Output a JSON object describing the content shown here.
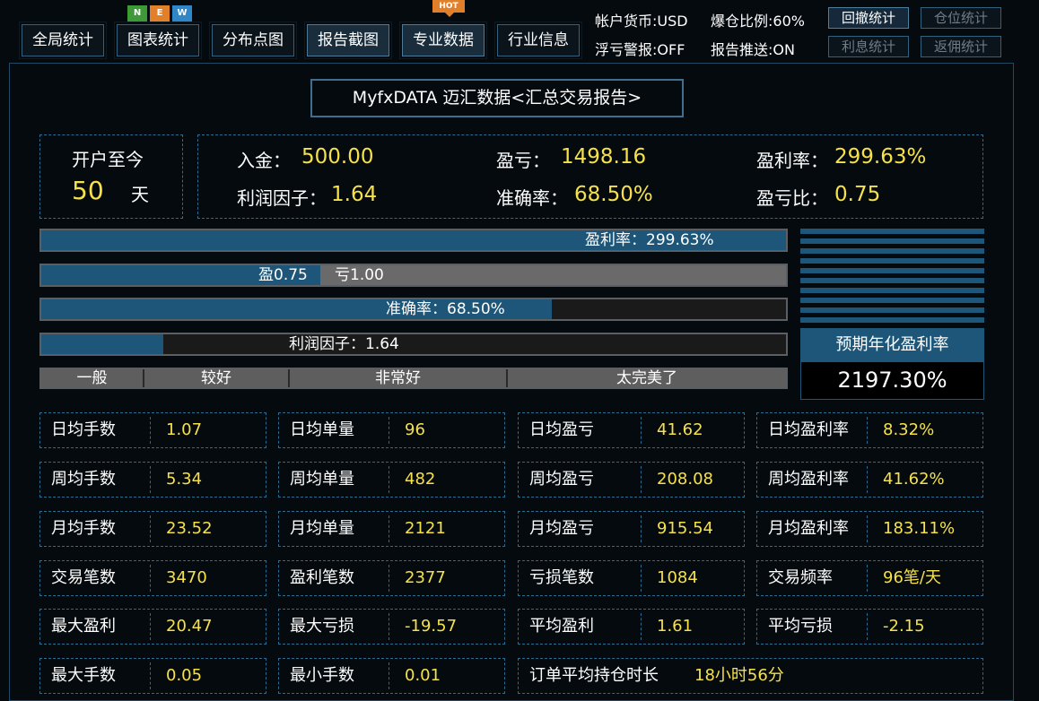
{
  "nav": {
    "tabs": [
      {
        "label": "全局统计",
        "active": false
      },
      {
        "label": "图表统计",
        "active": false,
        "badges": [
          "N",
          "E",
          "W"
        ]
      },
      {
        "label": "分布点图",
        "active": false
      },
      {
        "label": "报告截图",
        "active": true
      },
      {
        "label": "专业数据",
        "active": true,
        "badge": "HOT"
      },
      {
        "label": "行业信息",
        "active": false
      }
    ],
    "info": {
      "currency": "帐户货币:USD",
      "margin_ratio": "爆仓比例:60%",
      "float_alert": "浮亏警报:OFF",
      "report_push": "报告推送:ON"
    },
    "side_buttons": [
      {
        "label": "回撤统计",
        "enabled": true
      },
      {
        "label": "仓位统计",
        "enabled": false
      },
      {
        "label": "利息统计",
        "enabled": false
      },
      {
        "label": "返佣统计",
        "enabled": false
      }
    ]
  },
  "report_title": "MyfxDATA 迈汇数据<汇总交易报告>",
  "summary": {
    "since_open_label": "开户至今",
    "days": "50",
    "days_unit": "天",
    "deposit_label": "入金：",
    "deposit": "500.00",
    "pnl_label": "盈亏：",
    "pnl": "1498.16",
    "profit_rate_label": "盈利率：",
    "profit_rate": "299.63%",
    "profit_factor_label": "利润因子：",
    "profit_factor": "1.64",
    "accuracy_label": "准确率：",
    "accuracy": "68.50%",
    "win_loss_ratio_label": "盈亏比：",
    "win_loss_ratio": "0.75"
  },
  "bars": {
    "profit_rate_text": "盈利率：299.63%",
    "profit_rate_fill": 1.0,
    "win_text": "盈0.75",
    "loss_text": "亏1.00",
    "win_fill": 0.375,
    "accuracy_text": "准确率：68.50%",
    "accuracy_fill": 0.685,
    "profit_factor_text": "利润因子：1.64",
    "profit_factor_fill": 0.164
  },
  "scale": [
    "一般",
    "较好",
    "非常好",
    "太完美了"
  ],
  "annual": {
    "label": "预期年化盈利率",
    "value": "2197.30%"
  },
  "stats": [
    [
      {
        "k": "日均手数",
        "v": "1.07"
      },
      {
        "k": "日均单量",
        "v": "96"
      },
      {
        "k": "日均盈亏",
        "v": "41.62"
      },
      {
        "k": "日均盈利率",
        "v": "8.32%"
      }
    ],
    [
      {
        "k": "周均手数",
        "v": "5.34"
      },
      {
        "k": "周均单量",
        "v": "482"
      },
      {
        "k": "周均盈亏",
        "v": "208.08"
      },
      {
        "k": "周均盈利率",
        "v": "41.62%"
      }
    ],
    [
      {
        "k": "月均手数",
        "v": "23.52"
      },
      {
        "k": "月均单量",
        "v": "2121"
      },
      {
        "k": "月均盈亏",
        "v": "915.54"
      },
      {
        "k": "月均盈利率",
        "v": "183.11%"
      }
    ],
    [
      {
        "k": "交易笔数",
        "v": "3470"
      },
      {
        "k": "盈利笔数",
        "v": "2377"
      },
      {
        "k": "亏损笔数",
        "v": "1084"
      },
      {
        "k": "交易频率",
        "v": "96笔/天"
      }
    ],
    [
      {
        "k": "最大盈利",
        "v": "20.47"
      },
      {
        "k": "最大亏损",
        "v": "-19.57"
      },
      {
        "k": "平均盈利",
        "v": "1.61"
      },
      {
        "k": "平均亏损",
        "v": "-2.15"
      }
    ],
    [
      {
        "k": "最大手数",
        "v": "0.05"
      },
      {
        "k": "最小手数",
        "v": "0.01"
      },
      {
        "k": "订单平均持仓时长",
        "v": "18小时56分"
      }
    ]
  ],
  "colors": {
    "accent": "#1d5678",
    "value": "#f6e14b",
    "badge_n": "#3e9a36",
    "badge_e": "#e0802a",
    "badge_w": "#2f86c9",
    "hot": "#e0802a"
  }
}
